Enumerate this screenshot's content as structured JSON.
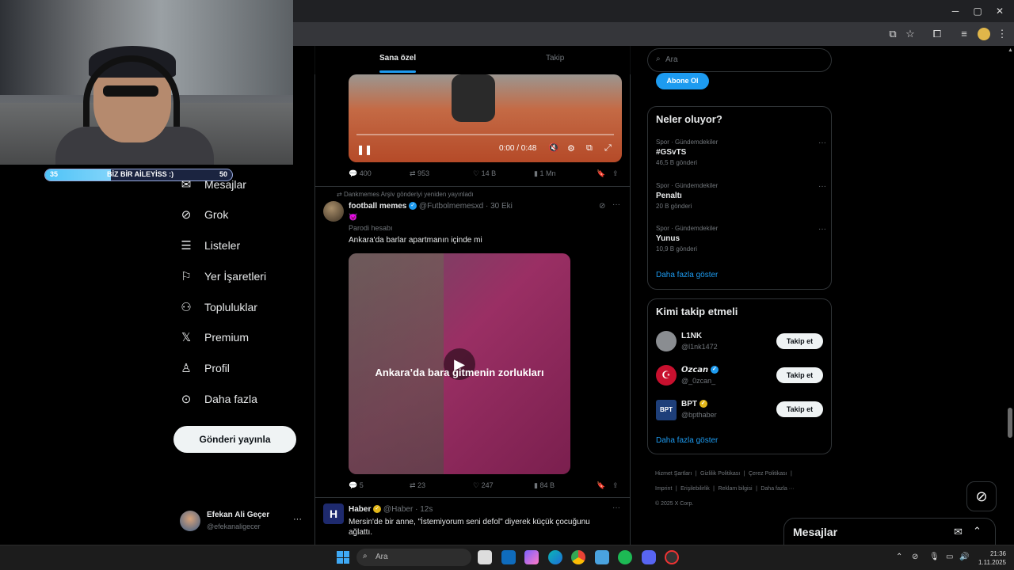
{
  "browser": {
    "window_controls": {
      "minimize": "─",
      "maximize": "▢",
      "close": "✕"
    }
  },
  "stream_overlay": {
    "bar_left": "35",
    "bar_label": "BİZ BİR AİLEYİSS :)",
    "bar_right": "50",
    "progress": 0.35
  },
  "nav": {
    "items": [
      {
        "label": "Mesajlar",
        "icon": "mail-icon"
      },
      {
        "label": "Grok",
        "icon": "grok-icon"
      },
      {
        "label": "Listeler",
        "icon": "list-icon"
      },
      {
        "label": "Yer İşaretleri",
        "icon": "bookmark-icon"
      },
      {
        "label": "Topluluklar",
        "icon": "communities-icon"
      },
      {
        "label": "Premium",
        "icon": "x-logo-icon"
      },
      {
        "label": "Profil",
        "icon": "person-icon"
      },
      {
        "label": "Daha fazla",
        "icon": "more-circle-icon"
      }
    ],
    "post_button": "Gönderi yayınla",
    "user": {
      "name": "Efekan Ali Geçer",
      "handle": "@efekanaligecer",
      "menu": "···"
    }
  },
  "feed": {
    "tabs": [
      "Sana özel",
      "Takip"
    ],
    "video_time": "0:00 / 0:48",
    "post1_stats": {
      "replies": "400",
      "reposts": "953",
      "likes": "14 B",
      "views": "1 Mn"
    },
    "post2": {
      "repost_note": "Dankmemes Arşiv gönderiyi yeniden yayınladı",
      "name": "football memes",
      "handle": "@Futbolmemesxd",
      "time": "· 30 Eki",
      "emoji": "😈",
      "parody": "Parodi hesabı",
      "text": "Ankara'da barlar apartmanın içinde mi",
      "video_caption": "Ankara’da bara gitmenin zorlukları",
      "stats": {
        "replies": "5",
        "reposts": "23",
        "likes": "247",
        "views": "84 B"
      }
    },
    "post3": {
      "name": "Haber",
      "handle": "@Haber",
      "time": "· 12s",
      "text": "Mersin'de bir anne, \"İstemiyorum seni defol\" diyerek küçük çocuğunu ağlattı.",
      "avatar_letter": "H"
    }
  },
  "sidebar": {
    "search_placeholder": "Ara",
    "subscribe_button": "Abone Ol",
    "trends_title": "Neler oluyor?",
    "trends": [
      {
        "category": "Spor · Gündemdekiler",
        "name": "#GSvTS",
        "count": "46,5 B gönderi"
      },
      {
        "category": "Spor · Gündemdekiler",
        "name": "Penaltı",
        "count": "20 B gönderi"
      },
      {
        "category": "Spor · Gündemdekiler",
        "name": "Yunus",
        "count": "10,9 B gönderi"
      }
    ],
    "show_more": "Daha fazla göster",
    "who_to_follow_title": "Kimi takip etmeli",
    "suggestions": [
      {
        "name": "L1NK",
        "handle": "@l1nk1472",
        "button": "Takip et"
      },
      {
        "name": "𝙊𝙯𝙘𝙖𝙣",
        "handle": "@_0zcan_",
        "button": "Takip et"
      },
      {
        "name": "BPT",
        "handle": "@bpthaber",
        "button": "Takip et"
      }
    ],
    "footer": [
      "Hizmet Şartları",
      "Gizlilik Politikası",
      "Çerez Politikası",
      "Imprint",
      "Erişilebilirlik",
      "Reklam bilgisi",
      "Daha fazla ···",
      "© 2025 X Corp."
    ],
    "messages_drawer": "Mesajlar"
  },
  "taskbar": {
    "search_placeholder": "Ara",
    "time": "21:36",
    "date": "1.11.2025"
  }
}
